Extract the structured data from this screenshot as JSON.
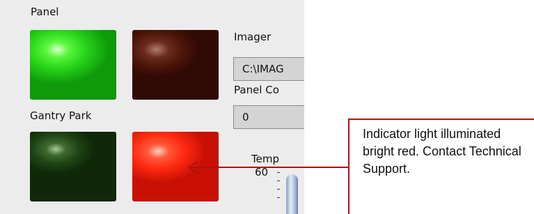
{
  "labels": {
    "panel": "Panel",
    "gantry_park": "Gantry Park",
    "imager": "Imager",
    "panel_code": "Panel Co",
    "temp": "Temp",
    "temp_scale_top": "60"
  },
  "fields": {
    "imager_path": "C:\\IMAG",
    "panel_code_value": "0"
  },
  "indicators": [
    {
      "name": "panel-indicator-1",
      "state": "on",
      "color": "#32ee1e"
    },
    {
      "name": "panel-indicator-2",
      "state": "off",
      "color": "#5a1a10"
    },
    {
      "name": "gantry-park-indicator-1",
      "state": "off",
      "color": "#1c3a12"
    },
    {
      "name": "gantry-park-indicator-2",
      "state": "on",
      "color": "#ff3316"
    }
  ],
  "callout": {
    "text": "Indicator light illuminated bright red. Contact Technical Support.",
    "border_color": "#b01010"
  }
}
